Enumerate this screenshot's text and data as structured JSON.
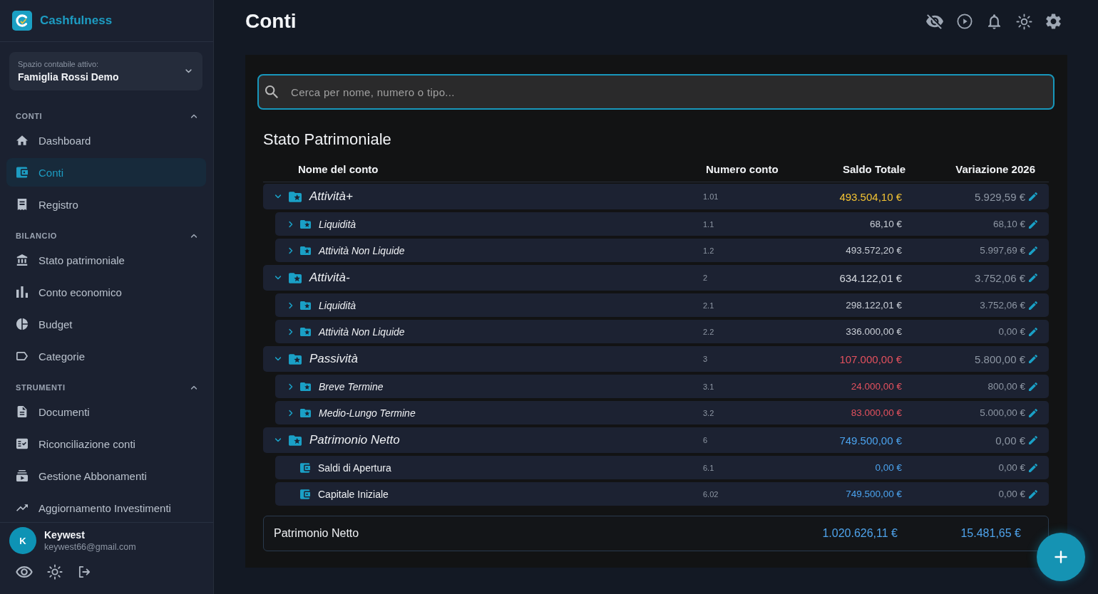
{
  "sidebar": {
    "brand": "Cashfulness",
    "workspace": {
      "label": "Spazio contabile attivo:",
      "name": "Famiglia Rossi Demo"
    },
    "sections": [
      {
        "title": "CONTI",
        "expanded": true,
        "items": [
          {
            "label": "Dashboard",
            "selected": false
          },
          {
            "label": "Conti",
            "selected": true
          },
          {
            "label": "Registro",
            "selected": false
          }
        ]
      },
      {
        "title": "BILANCIO",
        "expanded": true,
        "items": [
          {
            "label": "Stato patrimoniale",
            "selected": false
          },
          {
            "label": "Conto economico",
            "selected": false
          },
          {
            "label": "Budget",
            "selected": false
          },
          {
            "label": "Categorie",
            "selected": false
          }
        ]
      },
      {
        "title": "STRUMENTI",
        "expanded": true,
        "items": [
          {
            "label": "Documenti",
            "selected": false
          },
          {
            "label": "Riconciliazione conti",
            "selected": false
          },
          {
            "label": "Gestione Abbonamenti",
            "selected": false
          },
          {
            "label": "Aggiornamento Investimenti",
            "selected": false
          }
        ]
      }
    ],
    "user": {
      "initial": "K",
      "name": "Keywest",
      "email": "keywest66@gmail.com"
    }
  },
  "page_title": "Conti",
  "search": {
    "placeholder": "Cerca per nome, numero o tipo..."
  },
  "table": {
    "title": "Stato Patrimoniale",
    "columns": [
      "Nome del conto",
      "Numero conto",
      "Saldo Totale",
      "Variazione 2026"
    ],
    "rows": [
      {
        "kind": "group",
        "name": "Attività+",
        "number": "1.01",
        "balance": "493.504,10 €",
        "color": "#f2c233",
        "change": "5.929,59 €",
        "expanded": true,
        "children": [
          {
            "kind": "group",
            "name": "Liquidità",
            "number": "1.1",
            "balance": "68,10 €",
            "color": "#c9ced6",
            "change": "68,10 €",
            "expanded": false
          },
          {
            "kind": "group",
            "name": "Attività Non Liquide",
            "number": "1.2",
            "balance": "493.572,20 €",
            "color": "#c9ced6",
            "change": "5.997,69 €",
            "expanded": false
          }
        ]
      },
      {
        "kind": "group",
        "name": "Attività-",
        "number": "2",
        "balance": "634.122,01 €",
        "color": "#d4d8de",
        "change": "3.752,06 €",
        "expanded": true,
        "children": [
          {
            "kind": "group",
            "name": "Liquidità",
            "number": "2.1",
            "balance": "298.122,01 €",
            "color": "#c9ced6",
            "change": "3.752,06 €",
            "expanded": false
          },
          {
            "kind": "group",
            "name": "Attività Non Liquide",
            "number": "2.2",
            "balance": "336.000,00 €",
            "color": "#c9ced6",
            "change": "0,00 €",
            "expanded": false
          }
        ]
      },
      {
        "kind": "group",
        "name": "Passività",
        "number": "3",
        "balance": "107.000,00 €",
        "color": "#e4515e",
        "change": "5.800,00 €",
        "expanded": true,
        "children": [
          {
            "kind": "group",
            "name": "Breve Termine",
            "number": "3.1",
            "balance": "24.000,00 €",
            "color": "#e4515e",
            "change": "800,00 €",
            "expanded": false
          },
          {
            "kind": "group",
            "name": "Medio-Lungo Termine",
            "number": "3.2",
            "balance": "83.000,00 €",
            "color": "#e4515e",
            "change": "5.000,00 €",
            "expanded": false
          }
        ]
      },
      {
        "kind": "group",
        "name": "Patrimonio Netto",
        "number": "6",
        "balance": "749.500,00 €",
        "color": "#4ba3ee",
        "change": "0,00 €",
        "expanded": true,
        "children": [
          {
            "kind": "account",
            "name": "Saldi di Apertura",
            "number": "6.1",
            "balance": "0,00 €",
            "color": "#4ba3ee",
            "change": "0,00 €"
          },
          {
            "kind": "account",
            "name": "Capitale Iniziale",
            "number": "6.02",
            "balance": "749.500,00 €",
            "color": "#4ba3ee",
            "change": "0,00 €"
          }
        ]
      }
    ],
    "total": {
      "label": "Patrimonio Netto",
      "balance": "1.020.626,11 €",
      "change": "15.481,65 €"
    }
  }
}
